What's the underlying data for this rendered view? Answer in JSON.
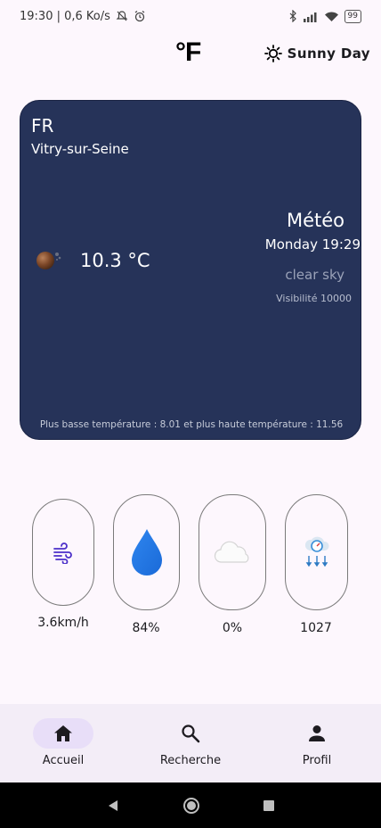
{
  "status_bar": {
    "time_net": "19:30 | 0,6 Ko/s",
    "battery": "99"
  },
  "header": {
    "unit": "°F",
    "theme_label": "Sunny Day"
  },
  "weather": {
    "country": "FR",
    "city": "Vitry-sur-Seine",
    "temperature": "10.3 °C",
    "title": "Météo",
    "datetime": "Monday 19:29",
    "description": "clear sky",
    "visibility": "Visibilité 10000",
    "temp_range": "Plus basse température : 8.01 et plus haute température : 11.56",
    "card_color": "#263359"
  },
  "metrics": [
    {
      "icon": "wind-icon",
      "value": "3.6km/h"
    },
    {
      "icon": "humidity-drop-icon",
      "value": "84%"
    },
    {
      "icon": "cloud-icon",
      "value": "0%"
    },
    {
      "icon": "pressure-icon",
      "value": "1027"
    }
  ],
  "nav": {
    "items": [
      {
        "label": "Accueil",
        "icon": "home-icon",
        "active": true
      },
      {
        "label": "Recherche",
        "icon": "search-icon",
        "active": false
      },
      {
        "label": "Profil",
        "icon": "person-icon",
        "active": false
      }
    ]
  }
}
